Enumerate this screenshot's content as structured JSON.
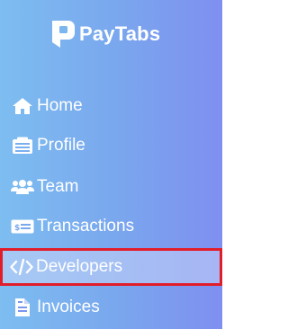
{
  "brand": {
    "name": "PayTabs",
    "logo_icon": "paytabs-logo"
  },
  "nav": {
    "items": [
      {
        "label": "Home",
        "icon": "home-icon"
      },
      {
        "label": "Profile",
        "icon": "profile-card-icon"
      },
      {
        "label": "Team",
        "icon": "users-icon"
      },
      {
        "label": "Transactions",
        "icon": "money-bill-icon"
      },
      {
        "label": "Developers",
        "icon": "code-icon",
        "active": true
      },
      {
        "label": "Invoices",
        "icon": "file-invoice-icon"
      }
    ]
  },
  "colors": {
    "text": "#ffffff",
    "active_outline": "#e11d2a",
    "gradient_start": "#7dbdf0",
    "gradient_end": "#7f8ff0"
  }
}
